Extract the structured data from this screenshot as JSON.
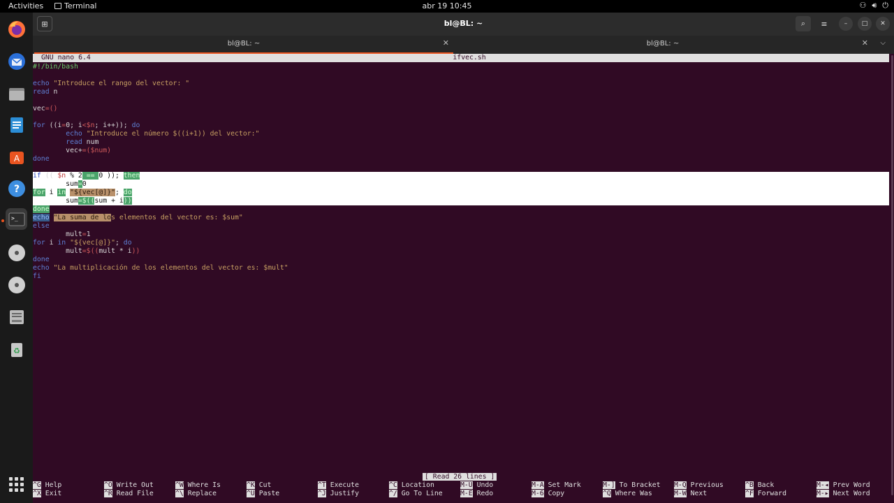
{
  "topbar": {
    "activities": "Activities",
    "app_name": "Terminal",
    "clock": "abr 19  10:45"
  },
  "window": {
    "title": "bl@BL: ~",
    "tabs": [
      {
        "label": "bl@BL: ~"
      },
      {
        "label": "bl@BL: ~"
      }
    ]
  },
  "nano": {
    "version": "GNU nano 6.4",
    "filename": "ifvec.sh",
    "status": "[ Read 26 lines ]",
    "shortcuts": [
      {
        "key": "^G",
        "label": "Help"
      },
      {
        "key": "^X",
        "label": "Exit"
      },
      {
        "key": "^O",
        "label": "Write Out"
      },
      {
        "key": "^R",
        "label": "Read File"
      },
      {
        "key": "^W",
        "label": "Where Is"
      },
      {
        "key": "^\\",
        "label": "Replace"
      },
      {
        "key": "^K",
        "label": "Cut"
      },
      {
        "key": "^U",
        "label": "Paste"
      },
      {
        "key": "^T",
        "label": "Execute"
      },
      {
        "key": "^J",
        "label": "Justify"
      },
      {
        "key": "^C",
        "label": "Location"
      },
      {
        "key": "^/",
        "label": "Go To Line"
      },
      {
        "key": "M-U",
        "label": "Undo"
      },
      {
        "key": "M-E",
        "label": "Redo"
      },
      {
        "key": "M-A",
        "label": "Set Mark"
      },
      {
        "key": "M-6",
        "label": "Copy"
      },
      {
        "key": "M-]",
        "label": "To Bracket"
      },
      {
        "key": "^Q",
        "label": "Where Was"
      },
      {
        "key": "M-Q",
        "label": "Previous"
      },
      {
        "key": "M-W",
        "label": "Next"
      },
      {
        "key": "^B",
        "label": "Back"
      },
      {
        "key": "^F",
        "label": "Forward"
      },
      {
        "key": "M-◂",
        "label": "Prev Word"
      },
      {
        "key": "M-▸",
        "label": "Next Word"
      }
    ],
    "lines": [
      [
        {
          "t": "#",
          "c": "cm"
        },
        {
          "t": "!/bin/bash",
          "c": "cm"
        }
      ],
      [],
      [
        {
          "t": "echo",
          "c": "kw"
        },
        {
          "t": " "
        },
        {
          "t": "\"Introduce el rango del vector: \"",
          "c": "str"
        }
      ],
      [
        {
          "t": "read",
          "c": "kw"
        },
        {
          "t": " n"
        }
      ],
      [],
      [
        {
          "t": "vec"
        },
        {
          "t": "=()",
          "c": "var"
        }
      ],
      [],
      [
        {
          "t": "for",
          "c": "kw"
        },
        {
          "t": " ((i"
        },
        {
          "t": "=",
          "c": "var"
        },
        {
          "t": "0; i"
        },
        {
          "t": "<",
          "c": "var"
        },
        {
          "t": "$n",
          "c": "var"
        },
        {
          "t": "; i++)); "
        },
        {
          "t": "do",
          "c": "kw"
        }
      ],
      [
        {
          "t": "        "
        },
        {
          "t": "echo",
          "c": "kw"
        },
        {
          "t": " "
        },
        {
          "t": "\"Introduce el número $((i+1)) del vector:\"",
          "c": "str"
        }
      ],
      [
        {
          "t": "        "
        },
        {
          "t": "read",
          "c": "kw"
        },
        {
          "t": " num"
        }
      ],
      [
        {
          "t": "        vec+"
        },
        {
          "t": "=(",
          "c": "var"
        },
        {
          "t": "$num",
          "c": "var"
        },
        {
          "t": ")",
          "c": "var"
        }
      ],
      [
        {
          "t": "done",
          "c": "kw"
        }
      ],
      [],
      [
        {
          "t": "if",
          "c": "kw"
        },
        {
          "t": " (( "
        },
        {
          "t": "$n",
          "c": "var"
        },
        {
          "t": " % ",
          "c": "plain"
        },
        {
          "t": "2",
          "c": "plain"
        },
        {
          "t": " == ",
          "c": "hlg"
        },
        {
          "t": "0 )); ",
          "c": "plain"
        },
        {
          "t": "then",
          "c": "hlg"
        }
      ],
      [
        {
          "t": "        sum",
          "c": "plain"
        },
        {
          "t": "=",
          "c": "hlg"
        },
        {
          "t": "0",
          "c": "plain"
        }
      ],
      [
        {
          "t": "for",
          "c": "hlg"
        },
        {
          "t": " i ",
          "c": "plain"
        },
        {
          "t": "in",
          "c": "hlg"
        },
        {
          "t": " ",
          "c": "plain"
        },
        {
          "t": "\"${vec[@]}\"",
          "c": "hlo"
        },
        {
          "t": "; ",
          "c": "plain"
        },
        {
          "t": "do",
          "c": "hlg"
        }
      ],
      [
        {
          "t": "        sum",
          "c": "plain"
        },
        {
          "t": "=$((",
          "c": "hlg"
        },
        {
          "t": "sum + i",
          "c": "plain"
        },
        {
          "t": "))",
          "c": "hlg"
        }
      ],
      [
        {
          "t": "done",
          "c": "hlg"
        }
      ],
      [
        {
          "t": "echo",
          "c": "hlb"
        },
        {
          "t": " "
        },
        {
          "t": "\"La suma de lo",
          "c": "hlo"
        },
        {
          "t": "s elementos del vector es: $sum\"",
          "c": "str"
        }
      ],
      [
        {
          "t": "else",
          "c": "kw"
        }
      ],
      [
        {
          "t": "        mult"
        },
        {
          "t": "=",
          "c": "var"
        },
        {
          "t": "1"
        }
      ],
      [
        {
          "t": "for",
          "c": "kw"
        },
        {
          "t": " i "
        },
        {
          "t": "in",
          "c": "kw"
        },
        {
          "t": " "
        },
        {
          "t": "\"${vec[@]}\"",
          "c": "str"
        },
        {
          "t": "; "
        },
        {
          "t": "do",
          "c": "kw"
        }
      ],
      [
        {
          "t": "        mult"
        },
        {
          "t": "=$((",
          "c": "var"
        },
        {
          "t": "mult * i"
        },
        {
          "t": "))",
          "c": "var"
        }
      ],
      [
        {
          "t": "done",
          "c": "kw"
        }
      ],
      [
        {
          "t": "echo",
          "c": "kw"
        },
        {
          "t": " "
        },
        {
          "t": "\"La multiplicación de los elementos del vector es: $mult\"",
          "c": "str"
        }
      ],
      [
        {
          "t": "fi",
          "c": "kw"
        }
      ]
    ],
    "selected_lines": [
      13,
      14,
      15,
      16
    ]
  }
}
